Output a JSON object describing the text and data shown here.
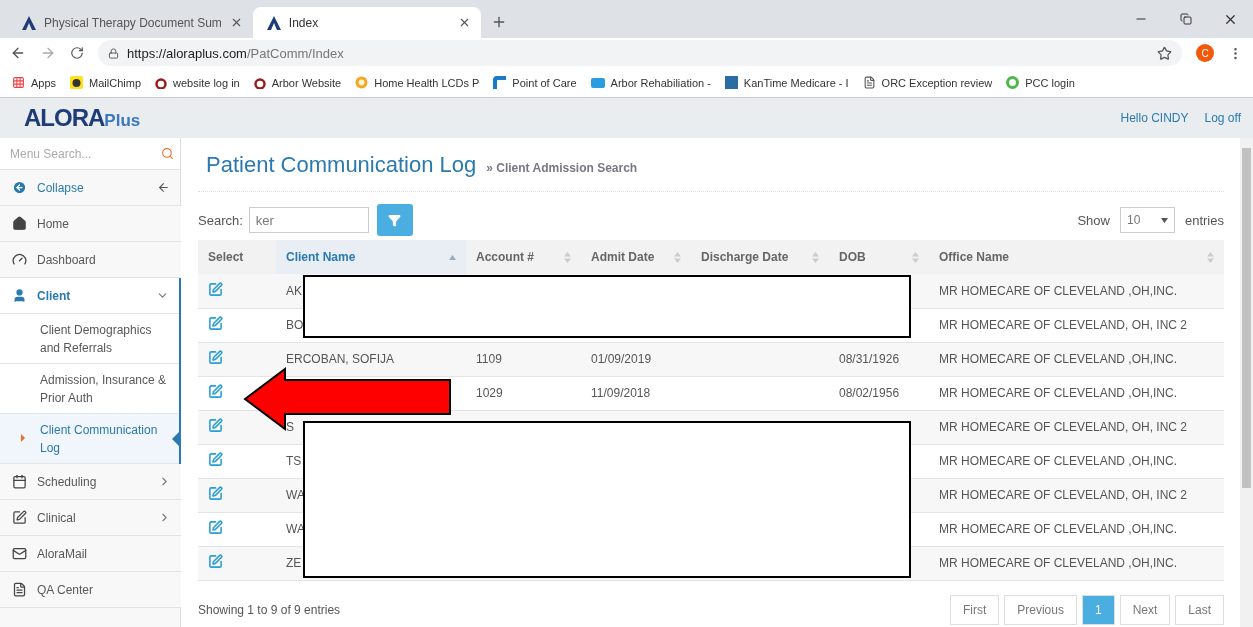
{
  "browser": {
    "tabs": [
      {
        "title": "Physical Therapy Document Sum",
        "selected": false
      },
      {
        "title": "Index",
        "selected": true
      }
    ],
    "url": {
      "host": "https://aloraplus.com",
      "path": "/PatComm/Index"
    },
    "profile": "C",
    "bookmarks": [
      {
        "label": "Apps",
        "kind": "apps"
      },
      {
        "label": "MailChimp",
        "kind": "chimp"
      },
      {
        "label": "website log in",
        "kind": "letter"
      },
      {
        "label": "Arbor Website",
        "kind": "letter"
      },
      {
        "label": "Home Health LCDs P",
        "kind": "badge"
      },
      {
        "label": "Point of Care",
        "kind": "corner"
      },
      {
        "label": "Arbor Rehabiliation -",
        "kind": "tile"
      },
      {
        "label": "KanTime Medicare - I",
        "kind": "kt"
      },
      {
        "label": "ORC Exception review",
        "kind": "doc"
      },
      {
        "label": "PCC login",
        "kind": "ring"
      }
    ]
  },
  "header": {
    "logo": {
      "name": "ALORA",
      "suffix": "Plus"
    },
    "greeting": "Hello CINDY",
    "logoff": "Log off"
  },
  "sidebar": {
    "search": {
      "placeholder": "Menu Search..."
    },
    "collapse": "Collapse",
    "items": [
      {
        "label": "Home",
        "kind": "home",
        "expandable": false,
        "expanded": false,
        "selected": false
      },
      {
        "label": "Dashboard",
        "kind": "gauge",
        "expandable": false,
        "expanded": false,
        "selected": false
      },
      {
        "label": "Client",
        "kind": "user",
        "expandable": true,
        "expanded": true,
        "selected": true,
        "children": [
          {
            "label": "Client Demographics and Referrals",
            "selected": false
          },
          {
            "label": "Admission, Insurance & Prior Auth",
            "selected": false
          },
          {
            "label": "Client Communication Log",
            "selected": true
          }
        ]
      },
      {
        "label": "Scheduling",
        "kind": "calendar",
        "expandable": true,
        "expanded": false,
        "selected": false
      },
      {
        "label": "Clinical",
        "kind": "edit",
        "expandable": true,
        "expanded": false,
        "selected": false
      },
      {
        "label": "AloraMail",
        "kind": "mail",
        "expandable": false,
        "expanded": false,
        "selected": false
      },
      {
        "label": "QA Center",
        "kind": "file",
        "expandable": false,
        "expanded": false,
        "selected": false
      }
    ]
  },
  "page": {
    "title": "Patient Communication Log",
    "breadcrumb": "» Client Admission Search"
  },
  "search": {
    "label": "Search:",
    "value": "ker"
  },
  "length": {
    "label_before": "Show",
    "value": "10",
    "label_after": "entries"
  },
  "table": {
    "columns": [
      {
        "label": "Select",
        "sortable": false,
        "sorted": false
      },
      {
        "label": "Client Name",
        "sortable": true,
        "sorted": true
      },
      {
        "label": "Account #",
        "sortable": true,
        "sorted": false
      },
      {
        "label": "Admit Date",
        "sortable": true,
        "sorted": false
      },
      {
        "label": "Discharge Date",
        "sortable": true,
        "sorted": false
      },
      {
        "label": "DOB",
        "sortable": true,
        "sorted": false
      },
      {
        "label": "Office Name",
        "sortable": true,
        "sorted": false
      }
    ],
    "rows": [
      {
        "client_name": "AK",
        "office_name": "MR HOMECARE OF CLEVELAND ,OH,INC."
      },
      {
        "client_name": "BO",
        "office_name": "MR HOMECARE OF CLEVELAND, OH, INC 2"
      },
      {
        "client_name": "ERCOBAN, SOFIJA",
        "account": "1109",
        "admit_date": "01/09/2019",
        "dob": "08/31/1926",
        "office_name": "MR HOMECARE OF CLEVELAND ,OH,INC."
      },
      {
        "account": "1029",
        "admit_date": "11/09/2018",
        "dob": "08/02/1956",
        "office_name": "MR HOMECARE OF CLEVELAND ,OH,INC."
      },
      {
        "client_name": "S",
        "office_name": "MR HOMECARE OF CLEVELAND, OH, INC 2"
      },
      {
        "client_name": "TS",
        "office_name": "MR HOMECARE OF CLEVELAND ,OH,INC."
      },
      {
        "client_name": "WA",
        "office_name": "MR HOMECARE OF CLEVELAND, OH, INC 2"
      },
      {
        "client_name": "WA",
        "office_name": "MR HOMECARE OF CLEVELAND ,OH,INC."
      },
      {
        "client_name": "ZE",
        "office_name": "MR HOMECARE OF CLEVELAND ,OH,INC."
      }
    ]
  },
  "info": "Showing 1 to 9 of 9 entries",
  "pagination": [
    {
      "label": "First",
      "selected": false
    },
    {
      "label": "Previous",
      "selected": false
    },
    {
      "label": "1",
      "selected": true
    },
    {
      "label": "Next",
      "selected": false
    },
    {
      "label": "Last",
      "selected": false
    }
  ],
  "annotations": [
    {
      "kind": "redaction"
    },
    {
      "kind": "redaction"
    },
    {
      "kind": "arrow"
    }
  ]
}
